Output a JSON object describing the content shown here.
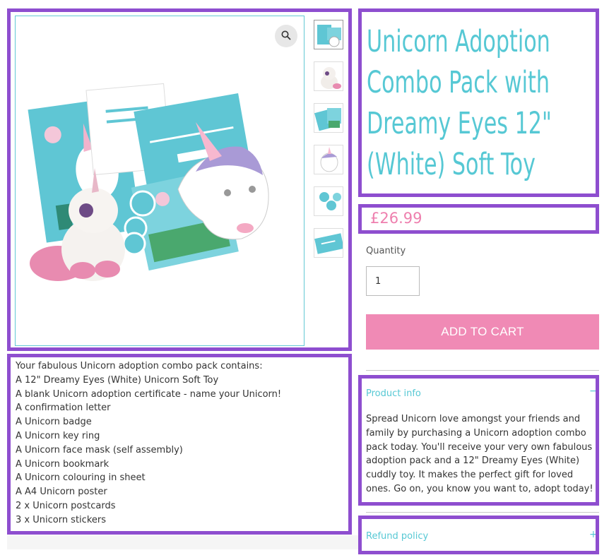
{
  "product": {
    "title": "Unicorn Adoption Combo Pack with Dreamy Eyes 12\" (White) Soft Toy",
    "price": "£26.99"
  },
  "purchase": {
    "quantity_label": "Quantity",
    "quantity_value": "1",
    "add_to_cart_label": "ADD TO CART"
  },
  "description": {
    "lines": [
      "Your fabulous Unicorn adoption combo pack contains:",
      "A 12\" Dreamy Eyes (White) Unicorn Soft Toy",
      "A blank Unicorn adoption certificate - name your Unicorn!",
      "A confirmation letter",
      "A Unicorn badge",
      "A Unicorn key ring",
      "A Unicorn face mask (self assembly)",
      "A Unicorn bookmark",
      "A Unicorn colouring in sheet",
      "A A4 Unicorn poster",
      "2 x Unicorn postcards",
      "3 x Unicorn stickers"
    ]
  },
  "accordion": {
    "product_info": {
      "label": "Product info",
      "toggle": "−",
      "text": "Spread Unicorn love amongst your friends and family by purchasing a Unicorn adoption combo pack today. You'll receive your very own fabulous adoption pack and a 12\" Dreamy Eyes (White) cuddly toy. It makes the perfect gift for loved ones. Go on, you know you want to, adopt today!"
    },
    "refund_policy": {
      "label": "Refund policy",
      "toggle": "+"
    }
  },
  "gallery": {
    "thumbnail_count": 6,
    "zoom_icon": "search-icon"
  },
  "colors": {
    "accent_teal": "#56c8d4",
    "accent_pink": "#ee7fae",
    "button_pink": "#f08ab5",
    "highlight": "#8e4ecf"
  }
}
